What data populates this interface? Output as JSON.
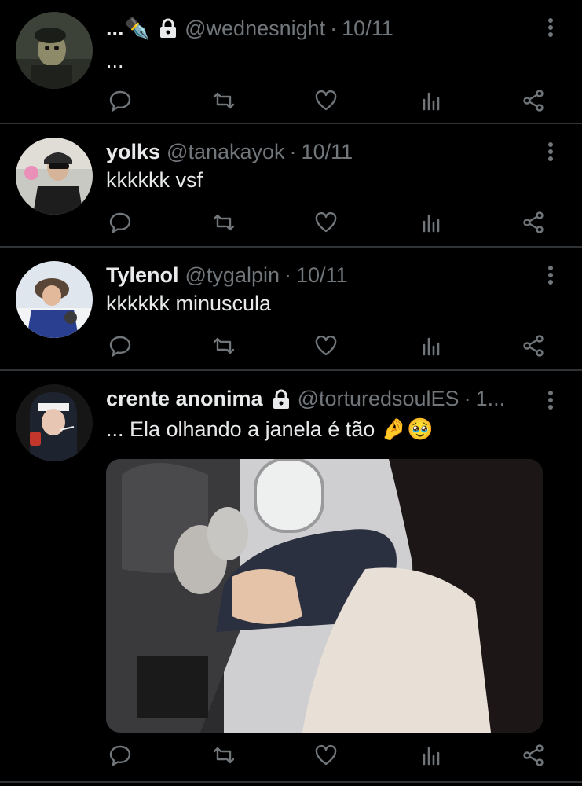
{
  "tweets": [
    {
      "name": "...✒️",
      "has_lock": true,
      "handle": "@wednesnight",
      "separator": "·",
      "date": "10/11",
      "text": "..."
    },
    {
      "name": "yolks",
      "has_lock": false,
      "handle": "@tanakayok",
      "separator": "·",
      "date": "10/11",
      "text": "kkkkkk vsf"
    },
    {
      "name": "Tylenol",
      "has_lock": false,
      "handle": "@tygalpin",
      "separator": "·",
      "date": "10/11",
      "text": "kkkkkk minuscula"
    },
    {
      "name": "crente anonima",
      "has_lock": true,
      "handle": "@torturedsoulES",
      "separator": "·",
      "date": "1...",
      "text": "... Ela olhando a janela é tão 🤌🥹",
      "media": "photo of a person sitting by an airplane window with knees up"
    }
  ],
  "icons": {
    "reply": "reply-icon",
    "retweet": "retweet-icon",
    "like": "like-icon",
    "views": "views-icon",
    "share": "share-icon",
    "more": "more-options-icon",
    "lock": "lock-icon"
  },
  "colors": {
    "background": "#000000",
    "primary_text": "#e7e9ea",
    "secondary_text": "#71767b",
    "divider": "#2f3336"
  }
}
